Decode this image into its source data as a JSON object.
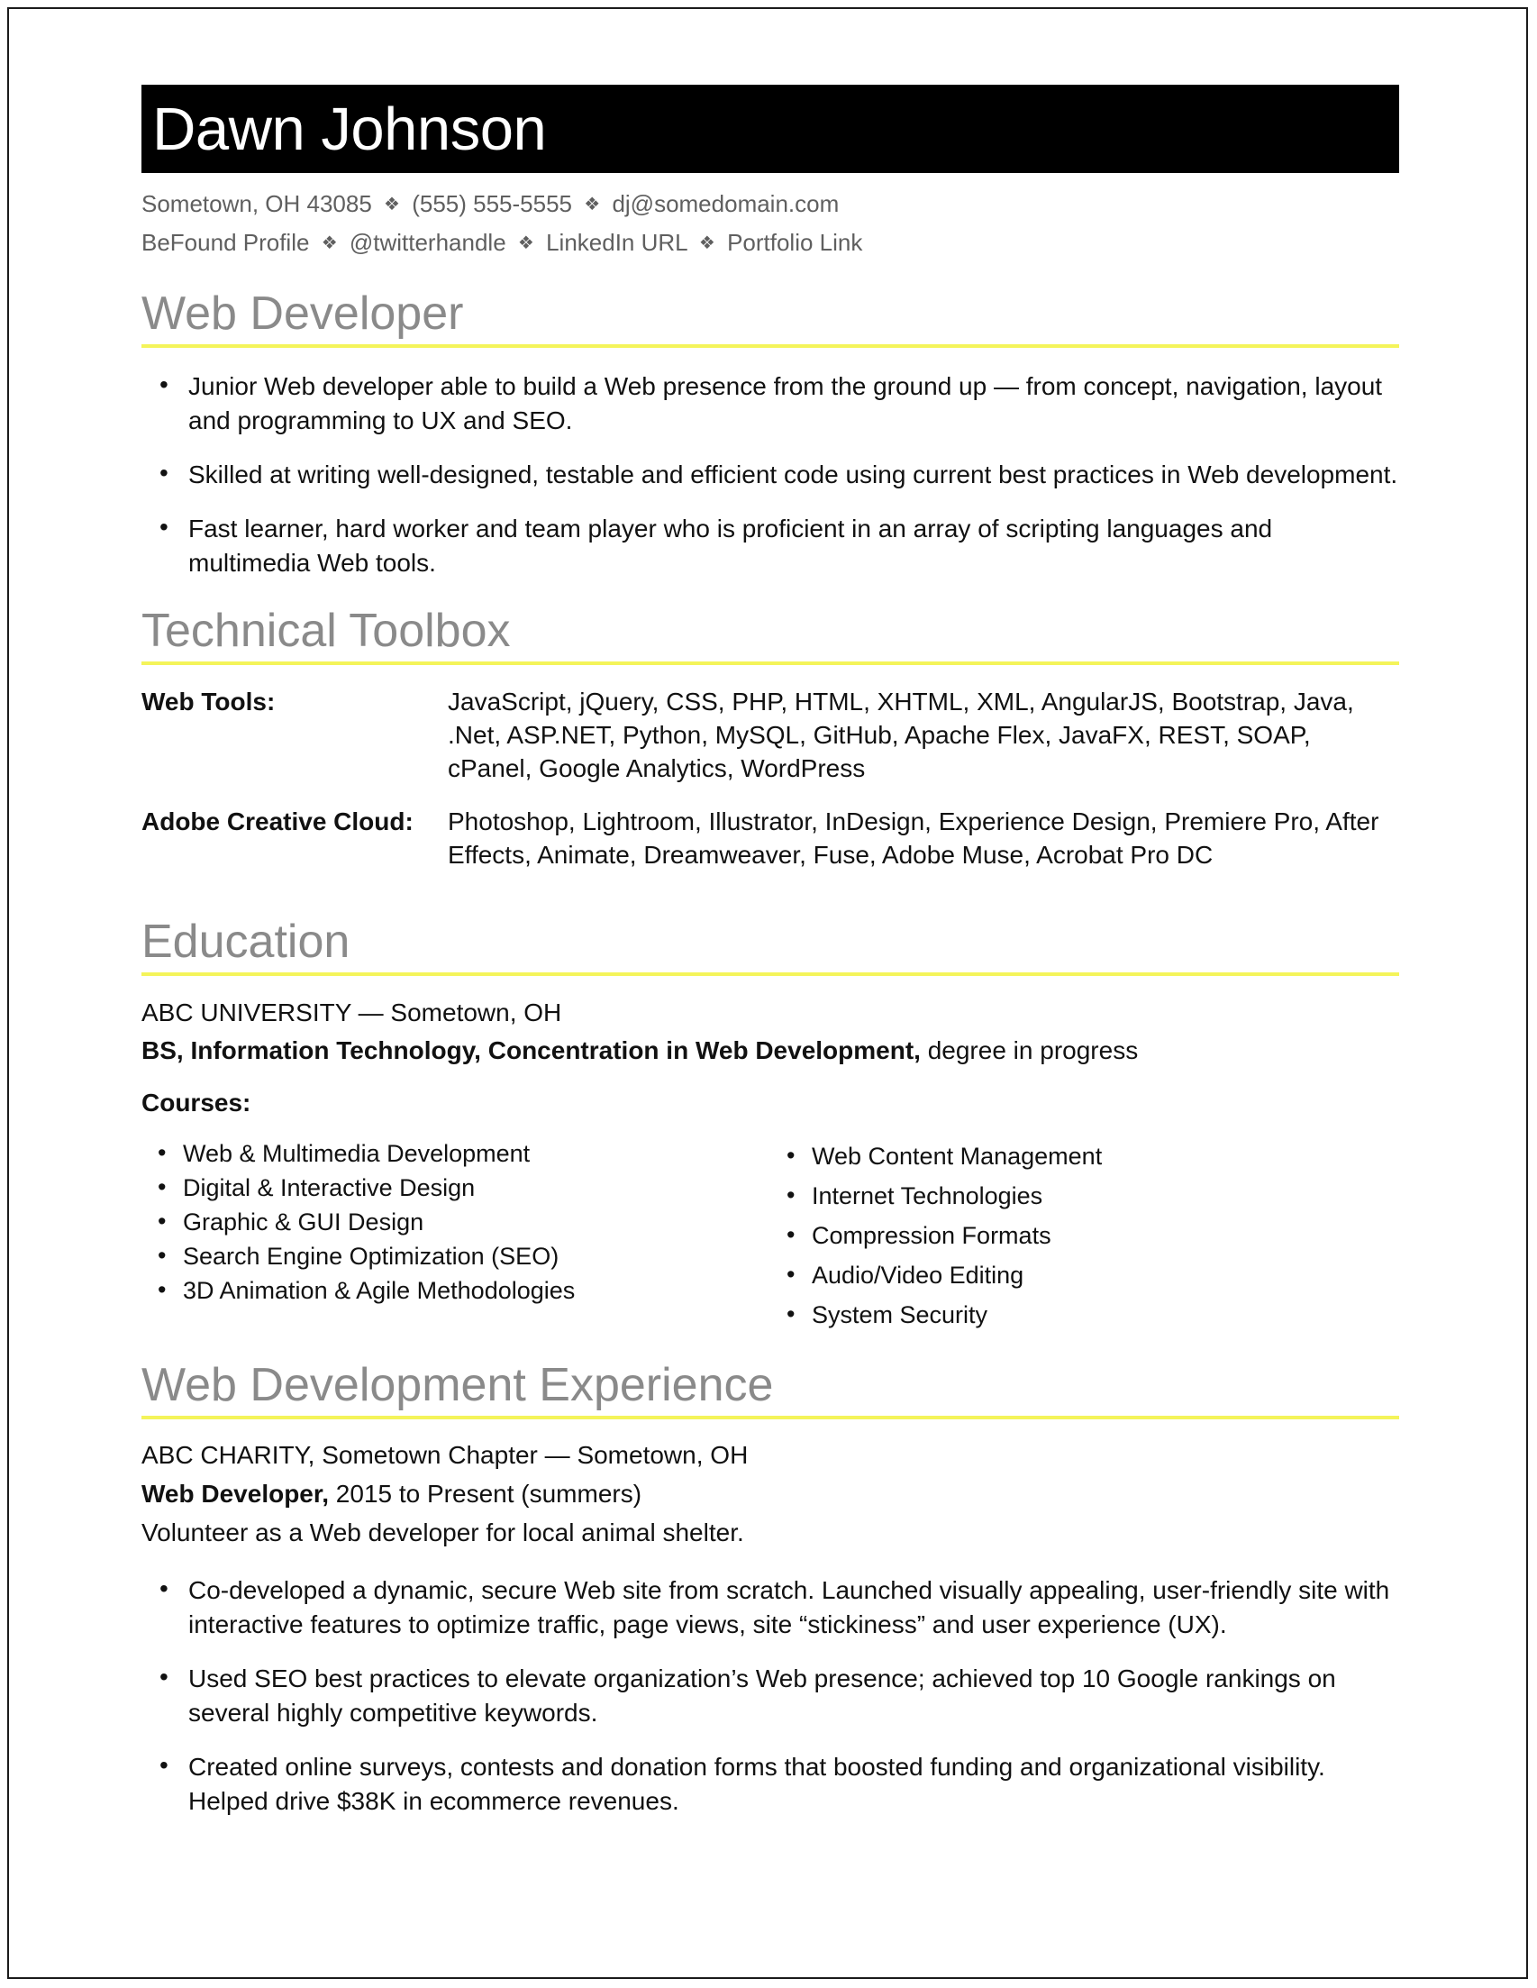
{
  "document": {
    "type": "resume",
    "accent_rule_color": "#f4f45a",
    "heading_color": "#8a8a8a",
    "name_bar_color": "#000000"
  },
  "header": {
    "name": "Dawn Johnson",
    "separator": "❖",
    "contact_line_1": [
      "Sometown, OH 43085",
      "(555) 555-5555",
      "dj@somedomain.com"
    ],
    "contact_line_2": [
      "BeFound Profile",
      "@twitterhandle",
      "LinkedIn URL",
      "Portfolio Link"
    ]
  },
  "summary": {
    "heading": "Web Developer",
    "bullets": [
      "Junior Web developer able to build a Web presence from the ground up — from concept, navigation, layout and programming to UX and SEO.",
      "Skilled at writing well-designed, testable and efficient code using current best practices in Web development.",
      "Fast learner, hard worker and team player who is proficient in an array of scripting languages and multimedia Web tools."
    ]
  },
  "toolbox": {
    "heading": "Technical Toolbox",
    "rows": [
      {
        "label": "Web Tools:",
        "value": "JavaScript, jQuery, CSS, PHP, HTML, XHTML, XML, AngularJS, Bootstrap, Java, .Net, ASP.NET, Python, MySQL, GitHub, Apache Flex, JavaFX, REST, SOAP, cPanel, Google Analytics, WordPress"
      },
      {
        "label": "Adobe Creative Cloud:",
        "value": "Photoshop, Lightroom, Illustrator, InDesign, Experience Design, Premiere Pro, After Effects, Animate, Dreamweaver, Fuse, Adobe Muse, Acrobat Pro DC"
      }
    ]
  },
  "education": {
    "heading": "Education",
    "school": "ABC UNIVERSITY — Sometown, OH",
    "degree_bold": "BS, Information Technology, Concentration in Web Development,",
    "degree_status": " degree in progress",
    "courses_label": "Courses:",
    "courses_left": [
      "Web & Multimedia Development",
      "Digital & Interactive Design",
      "Graphic & GUI Design",
      "Search Engine Optimization (SEO)",
      "3D Animation & Agile Methodologies"
    ],
    "courses_right": [
      "Web Content Management",
      "Internet Technologies",
      "Compression Formats",
      "Audio/Video Editing",
      "System Security"
    ]
  },
  "experience": {
    "heading": "Web Development Experience",
    "employer": "ABC CHARITY, Sometown Chapter — Sometown, OH",
    "title_bold": "Web Developer,",
    "title_dates": " 2015 to Present (summers)",
    "blurb": "Volunteer as a Web developer for local animal shelter.",
    "bullets": [
      "Co-developed a dynamic, secure Web site from scratch. Launched visually appealing, user-friendly site with interactive features to optimize traffic, page views, site “stickiness” and user experience (UX).",
      "Used SEO best practices to elevate organization’s Web presence; achieved top 10 Google rankings on several highly competitive keywords.",
      "Created online surveys, contests and donation forms that boosted funding and organizational visibility. Helped drive $38K in ecommerce revenues."
    ]
  }
}
